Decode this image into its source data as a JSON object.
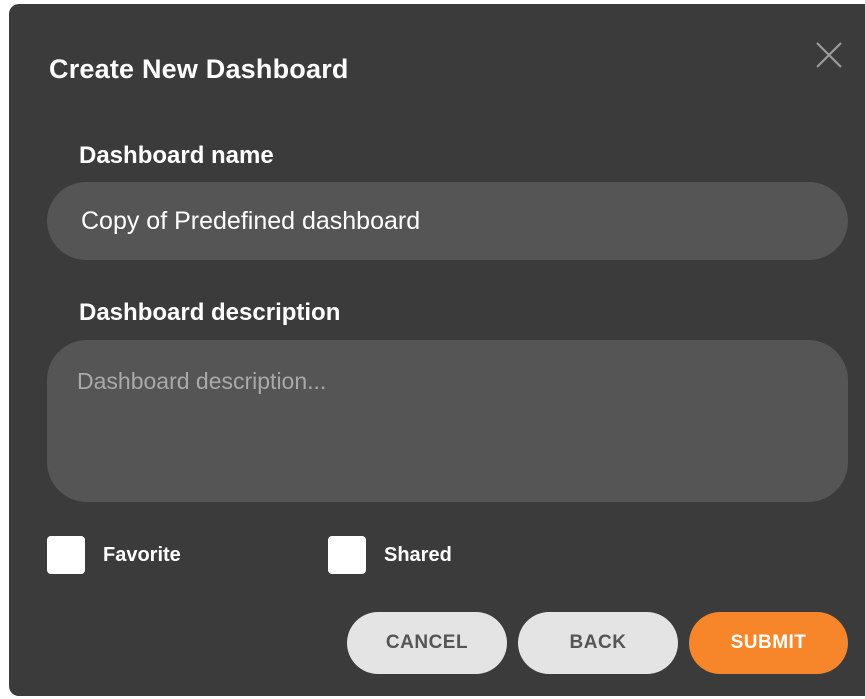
{
  "dialog": {
    "title": "Create New Dashboard",
    "close_icon": "close-icon"
  },
  "form": {
    "name_label": "Dashboard name",
    "name_value": "Copy of Predefined dashboard",
    "description_label": "Dashboard description",
    "description_placeholder": "Dashboard description...",
    "description_value": ""
  },
  "options": {
    "favorite_label": "Favorite",
    "favorite_checked": false,
    "shared_label": "Shared",
    "shared_checked": false
  },
  "buttons": {
    "cancel": "CANCEL",
    "back": "BACK",
    "submit": "SUBMIT"
  },
  "colors": {
    "dialog_bg": "#3b3b3b",
    "input_bg": "#555555",
    "secondary_button": "#e4e4e4",
    "accent": "#f7862a"
  }
}
